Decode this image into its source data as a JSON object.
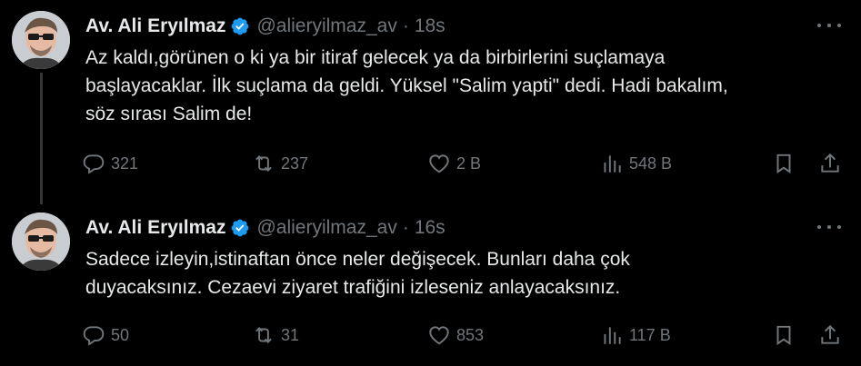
{
  "tweets": [
    {
      "name": "Av. Ali Eryılmaz",
      "handle": "@alieryilmaz_av",
      "separator": "·",
      "time": "18s",
      "text": "Az kaldı,görünen o ki ya bir itiraf gelecek ya da birbirlerini suçlamaya\nbaşlayacaklar. İlk suçlama da geldi. Yüksel \"Salim yapti\" dedi. Hadi bakalım,\nsöz sırası Salim de!",
      "replies": "321",
      "retweets": "237",
      "likes": "2 B",
      "views": "548 B"
    },
    {
      "name": "Av. Ali Eryılmaz",
      "handle": "@alieryilmaz_av",
      "separator": "·",
      "time": "16s",
      "text": "Sadece izleyin,istinaftan önce neler değişecek. Bunları daha çok\nduyacaksınız. Cezaevi ziyaret trafiğini izleseniz anlayacaksınız.",
      "replies": "50",
      "retweets": "31",
      "likes": "853",
      "views": "117 B"
    }
  ],
  "colors": {
    "background": "#000000",
    "text": "#e7e9ea",
    "muted": "#71767b",
    "verified": "#1d9bf0",
    "thread_line": "#333639"
  }
}
